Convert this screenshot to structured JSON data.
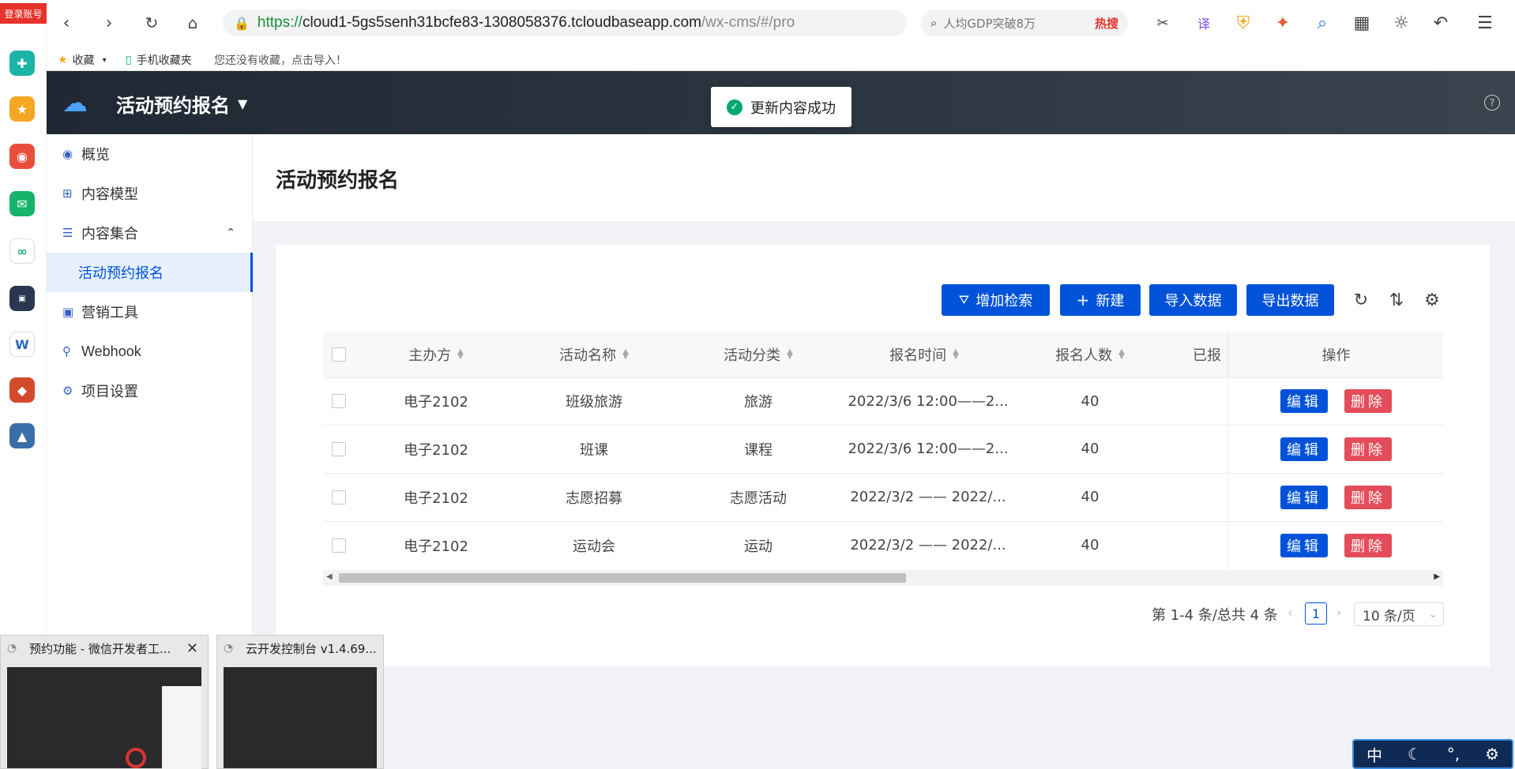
{
  "browser": {
    "url_prefix": "https://",
    "url_host": "cloud1-5gs5senh31bcfe83-1308058376.tcloudbaseapp.com",
    "url_path": "/wx-cms/#/pro",
    "search_placeholder": "人均GDP突破8万",
    "search_hot": "热搜",
    "login_badge": "登录账号"
  },
  "bookmarks": {
    "favorites": "收藏",
    "mobile": "手机收藏夹",
    "hint": "您还没有收藏，点击导入！"
  },
  "app": {
    "title": "活动预约报名",
    "help": "?"
  },
  "toast": {
    "message": "更新内容成功"
  },
  "sidebar": {
    "items": [
      {
        "label": "概览"
      },
      {
        "label": "内容模型"
      },
      {
        "label": "内容集合"
      },
      {
        "label": "活动预约报名"
      },
      {
        "label": "营销工具"
      },
      {
        "label": "Webhook"
      },
      {
        "label": "项目设置"
      }
    ]
  },
  "page": {
    "title": "活动预约报名"
  },
  "toolbar": {
    "add_filter": "增加检索",
    "new": "新建",
    "import": "导入数据",
    "export": "导出数据"
  },
  "table": {
    "columns": [
      "主办方",
      "活动名称",
      "活动分类",
      "报名时间",
      "报名人数",
      "已报",
      "操作"
    ],
    "rows": [
      {
        "host": "电子2102",
        "name": "班级旅游",
        "category": "旅游",
        "time": "2022/3/6 12:00——2...",
        "count": "40"
      },
      {
        "host": "电子2102",
        "name": "班课",
        "category": "课程",
        "time": "2022/3/6 12:00——2...",
        "count": "40"
      },
      {
        "host": "电子2102",
        "name": "志愿招募",
        "category": "志愿活动",
        "time": "2022/3/2 —— 2022/...",
        "count": "40"
      },
      {
        "host": "电子2102",
        "name": "运动会",
        "category": "运动",
        "time": "2022/3/2 —— 2022/...",
        "count": "40"
      }
    ],
    "edit_label": "编辑",
    "delete_label": "删除"
  },
  "pagination": {
    "summary": "第 1-4 条/总共 4 条",
    "current_page": "1",
    "page_size": "10 条/页"
  },
  "taskbar": {
    "thumb1_title": "预约功能 - 微信开发者工...",
    "thumb2_title": "云开发控制台 v1.4.69...",
    "ime": "中"
  }
}
